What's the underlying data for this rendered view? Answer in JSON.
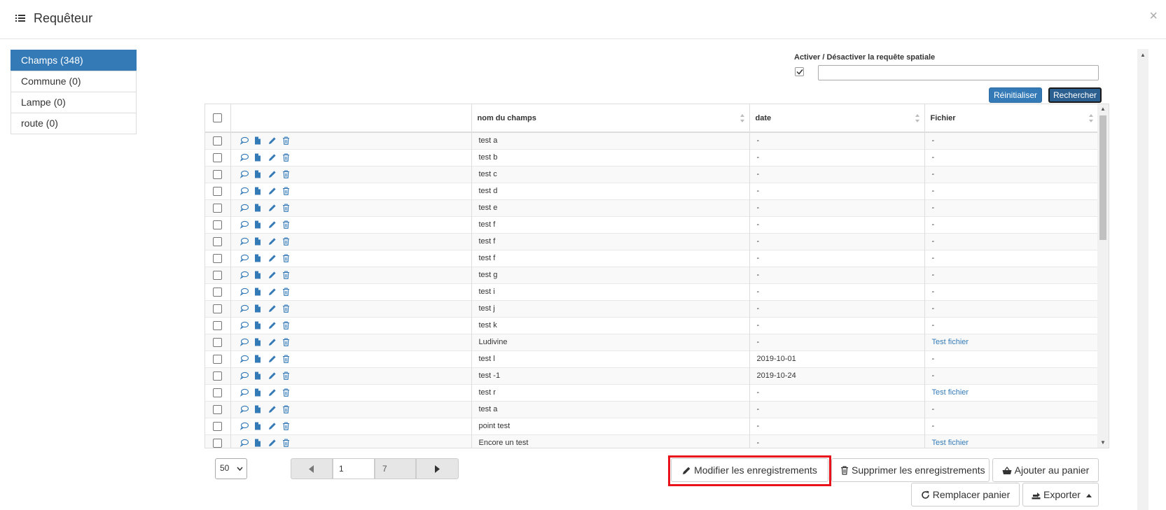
{
  "header": {
    "title": "Requêteur",
    "close": "×"
  },
  "sidebar": {
    "items": [
      {
        "label": "Champs (348)",
        "active": true
      },
      {
        "label": "Commune (0)",
        "active": false
      },
      {
        "label": "Lampe (0)",
        "active": false
      },
      {
        "label": "route (0)",
        "active": false
      }
    ]
  },
  "spatial": {
    "label": "Activer / Désactiver la requête spatiale",
    "checked": true,
    "value": ""
  },
  "filters": {
    "reset_label": "Réinitialiser",
    "search_label": "Rechercher"
  },
  "table": {
    "columns": [
      "nom du champs",
      "date",
      "Fichier"
    ],
    "rows": [
      {
        "nom": "test a",
        "date": "-",
        "fichier": "-"
      },
      {
        "nom": "test b",
        "date": "-",
        "fichier": "-"
      },
      {
        "nom": "test c",
        "date": "-",
        "fichier": "-"
      },
      {
        "nom": "test d",
        "date": "-",
        "fichier": "-"
      },
      {
        "nom": "test e",
        "date": "-",
        "fichier": "-"
      },
      {
        "nom": "test f",
        "date": "-",
        "fichier": "-"
      },
      {
        "nom": "test f",
        "date": "-",
        "fichier": "-"
      },
      {
        "nom": "test f",
        "date": "-",
        "fichier": "-"
      },
      {
        "nom": "test g",
        "date": "-",
        "fichier": "-"
      },
      {
        "nom": "test i",
        "date": "-",
        "fichier": "-"
      },
      {
        "nom": "test j",
        "date": "-",
        "fichier": "-"
      },
      {
        "nom": "test k",
        "date": "-",
        "fichier": "-"
      },
      {
        "nom": "Ludivine",
        "date": "-",
        "fichier": "Test fichier"
      },
      {
        "nom": "test l",
        "date": "2019-10-01",
        "fichier": "-"
      },
      {
        "nom": "test -1",
        "date": "2019-10-24",
        "fichier": "-"
      },
      {
        "nom": "test r",
        "date": "-",
        "fichier": "Test fichier"
      },
      {
        "nom": "test a",
        "date": "-",
        "fichier": "-"
      },
      {
        "nom": "point test",
        "date": "-",
        "fichier": "-"
      },
      {
        "nom": "Encore un test",
        "date": "-",
        "fichier": "Test fichier"
      }
    ]
  },
  "pagination": {
    "page_size": "50",
    "current_page": "1",
    "total_pages": "7"
  },
  "actions": {
    "modify": "Modifier les enregistrements",
    "delete": "Supprimer les enregistrements",
    "add_cart": "Ajouter au panier",
    "replace_cart": "Remplacer panier",
    "export": "Exporter"
  },
  "colors": {
    "primary": "#337ab7",
    "highlight": "#e8121b",
    "link": "#337ab7"
  },
  "icons": [
    "list-icon",
    "comment-icon",
    "file-icon",
    "pencil-icon",
    "trash-icon",
    "shopping-basket-icon",
    "refresh-icon",
    "export-icon",
    "caret-up-icon"
  ]
}
